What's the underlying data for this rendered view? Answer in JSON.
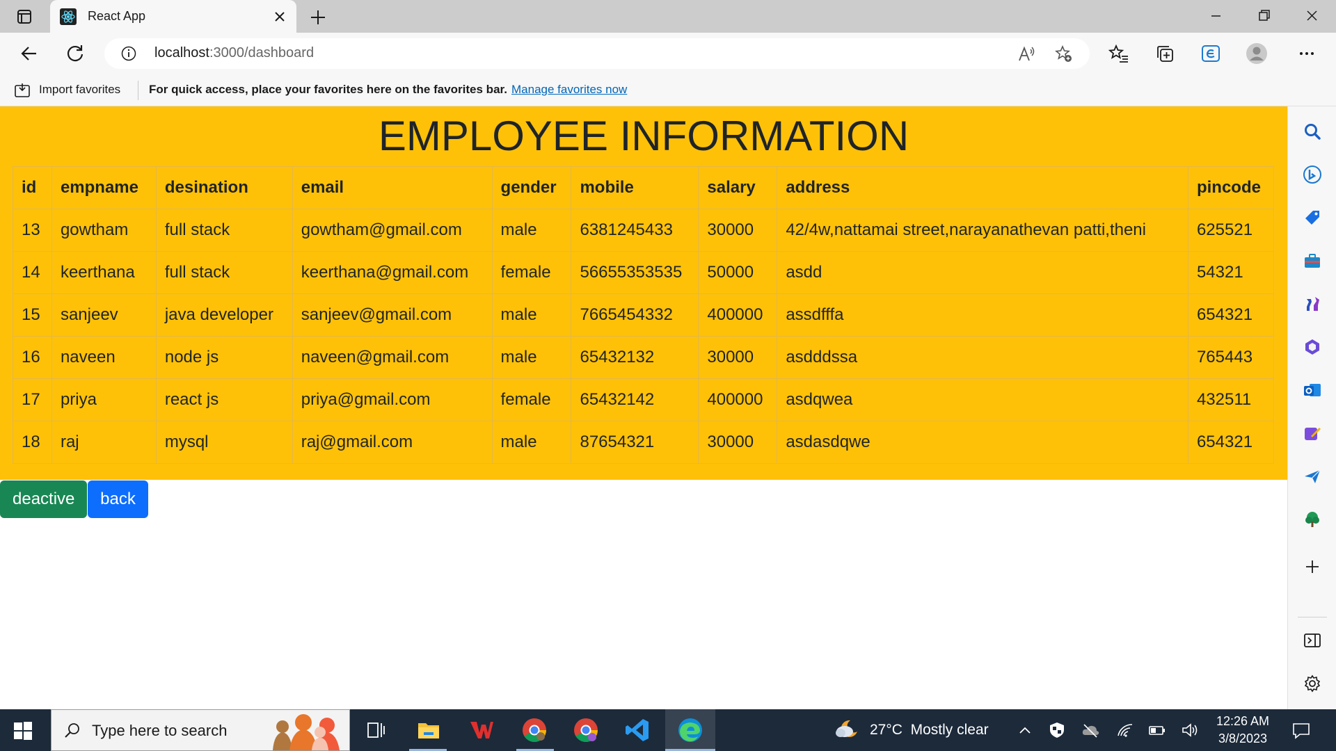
{
  "browser": {
    "tab_title": "React App",
    "url_host": "localhost",
    "url_rest": ":3000/dashboard"
  },
  "favorites_bar": {
    "import_label": "Import favorites",
    "hint": "For quick access, place your favorites here on the favorites bar.",
    "manage_link": "Manage favorites now"
  },
  "page": {
    "title": "EMPLOYEE INFORMATION",
    "columns": [
      "id",
      "empname",
      "desination",
      "email",
      "gender",
      "mobile",
      "salary",
      "address",
      "pincode"
    ],
    "rows": [
      [
        "13",
        "gowtham",
        "full stack",
        "gowtham@gmail.com",
        "male",
        "6381245433",
        "30000",
        "42/4w,nattamai street,narayanathevan patti,theni",
        "625521"
      ],
      [
        "14",
        "keerthana",
        "full stack",
        "keerthana@gmail.com",
        "female",
        "56655353535",
        "50000",
        "asdd",
        "54321"
      ],
      [
        "15",
        "sanjeev",
        "java developer",
        "sanjeev@gmail.com",
        "male",
        "7665454332",
        "400000",
        "assdfffa",
        "654321"
      ],
      [
        "16",
        "naveen",
        "node js",
        "naveen@gmail.com",
        "male",
        "65432132",
        "30000",
        "asdddssa",
        "765443"
      ],
      [
        "17",
        "priya",
        "react js",
        "priya@gmail.com",
        "female",
        "65432142",
        "400000",
        "asdqwea",
        "432511"
      ],
      [
        "18",
        "raj",
        "mysql",
        "raj@gmail.com",
        "male",
        "87654321",
        "30000",
        "asdasdqwe",
        "654321"
      ]
    ],
    "buttons": {
      "deactive": "deactive",
      "back": "back"
    }
  },
  "taskbar": {
    "search_placeholder": "Type here to search",
    "weather": "27°C  Mostly clear",
    "time": "12:26 AM",
    "date": "3/8/2023"
  },
  "colors": {
    "panel": "#ffc107",
    "deactive_button": "#198754",
    "back_button": "#0d6efd",
    "taskbar": "#1c2a3a"
  }
}
